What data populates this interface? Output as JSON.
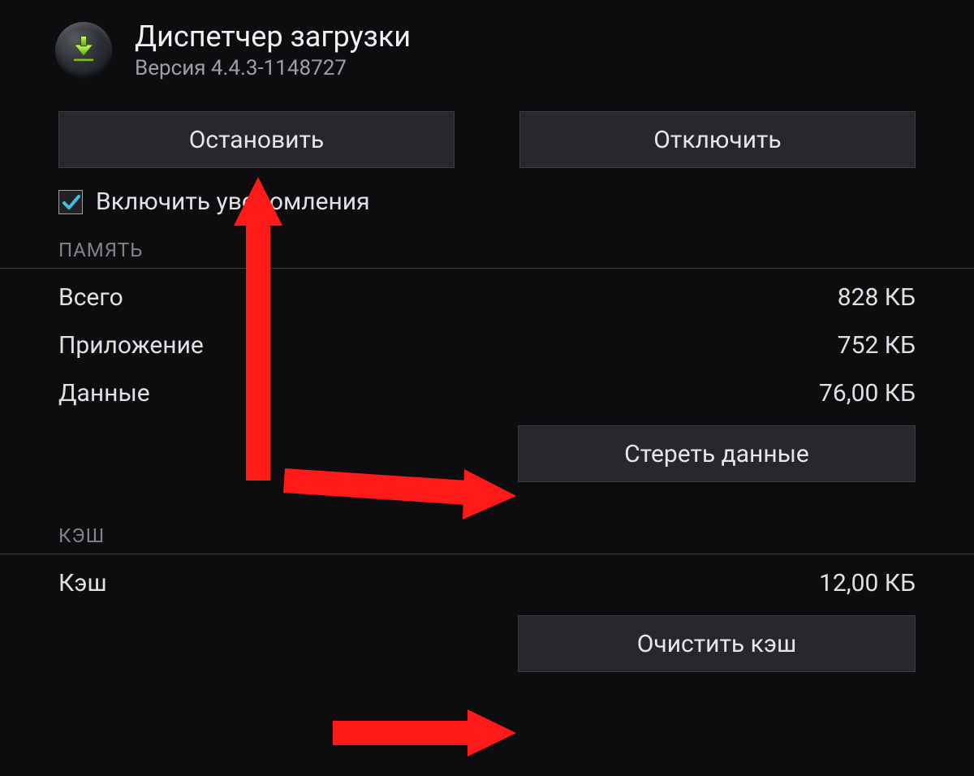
{
  "header": {
    "title": "Диспетчер загрузки",
    "version": "Версия 4.4.3-1148727",
    "icon": "download-icon"
  },
  "controls": {
    "stop_label": "Остановить",
    "disable_label": "Отключить"
  },
  "notifications": {
    "label": "Включить уведомления",
    "checked": true
  },
  "storage": {
    "section": "ПАМЯТЬ",
    "rows": [
      {
        "label": "Всего",
        "value": "828 КБ"
      },
      {
        "label": "Приложение",
        "value": "752 КБ"
      },
      {
        "label": "Данные",
        "value": "76,00 КБ"
      }
    ],
    "clear_data_label": "Стереть данные"
  },
  "cache": {
    "section": "КЭШ",
    "rows": [
      {
        "label": "Кэш",
        "value": "12,00 КБ"
      }
    ],
    "clear_cache_label": "Очистить кэш"
  },
  "annotations": {
    "arrows": [
      "arrow-to-stop",
      "arrow-to-clear-data",
      "arrow-to-clear-cache"
    ]
  }
}
